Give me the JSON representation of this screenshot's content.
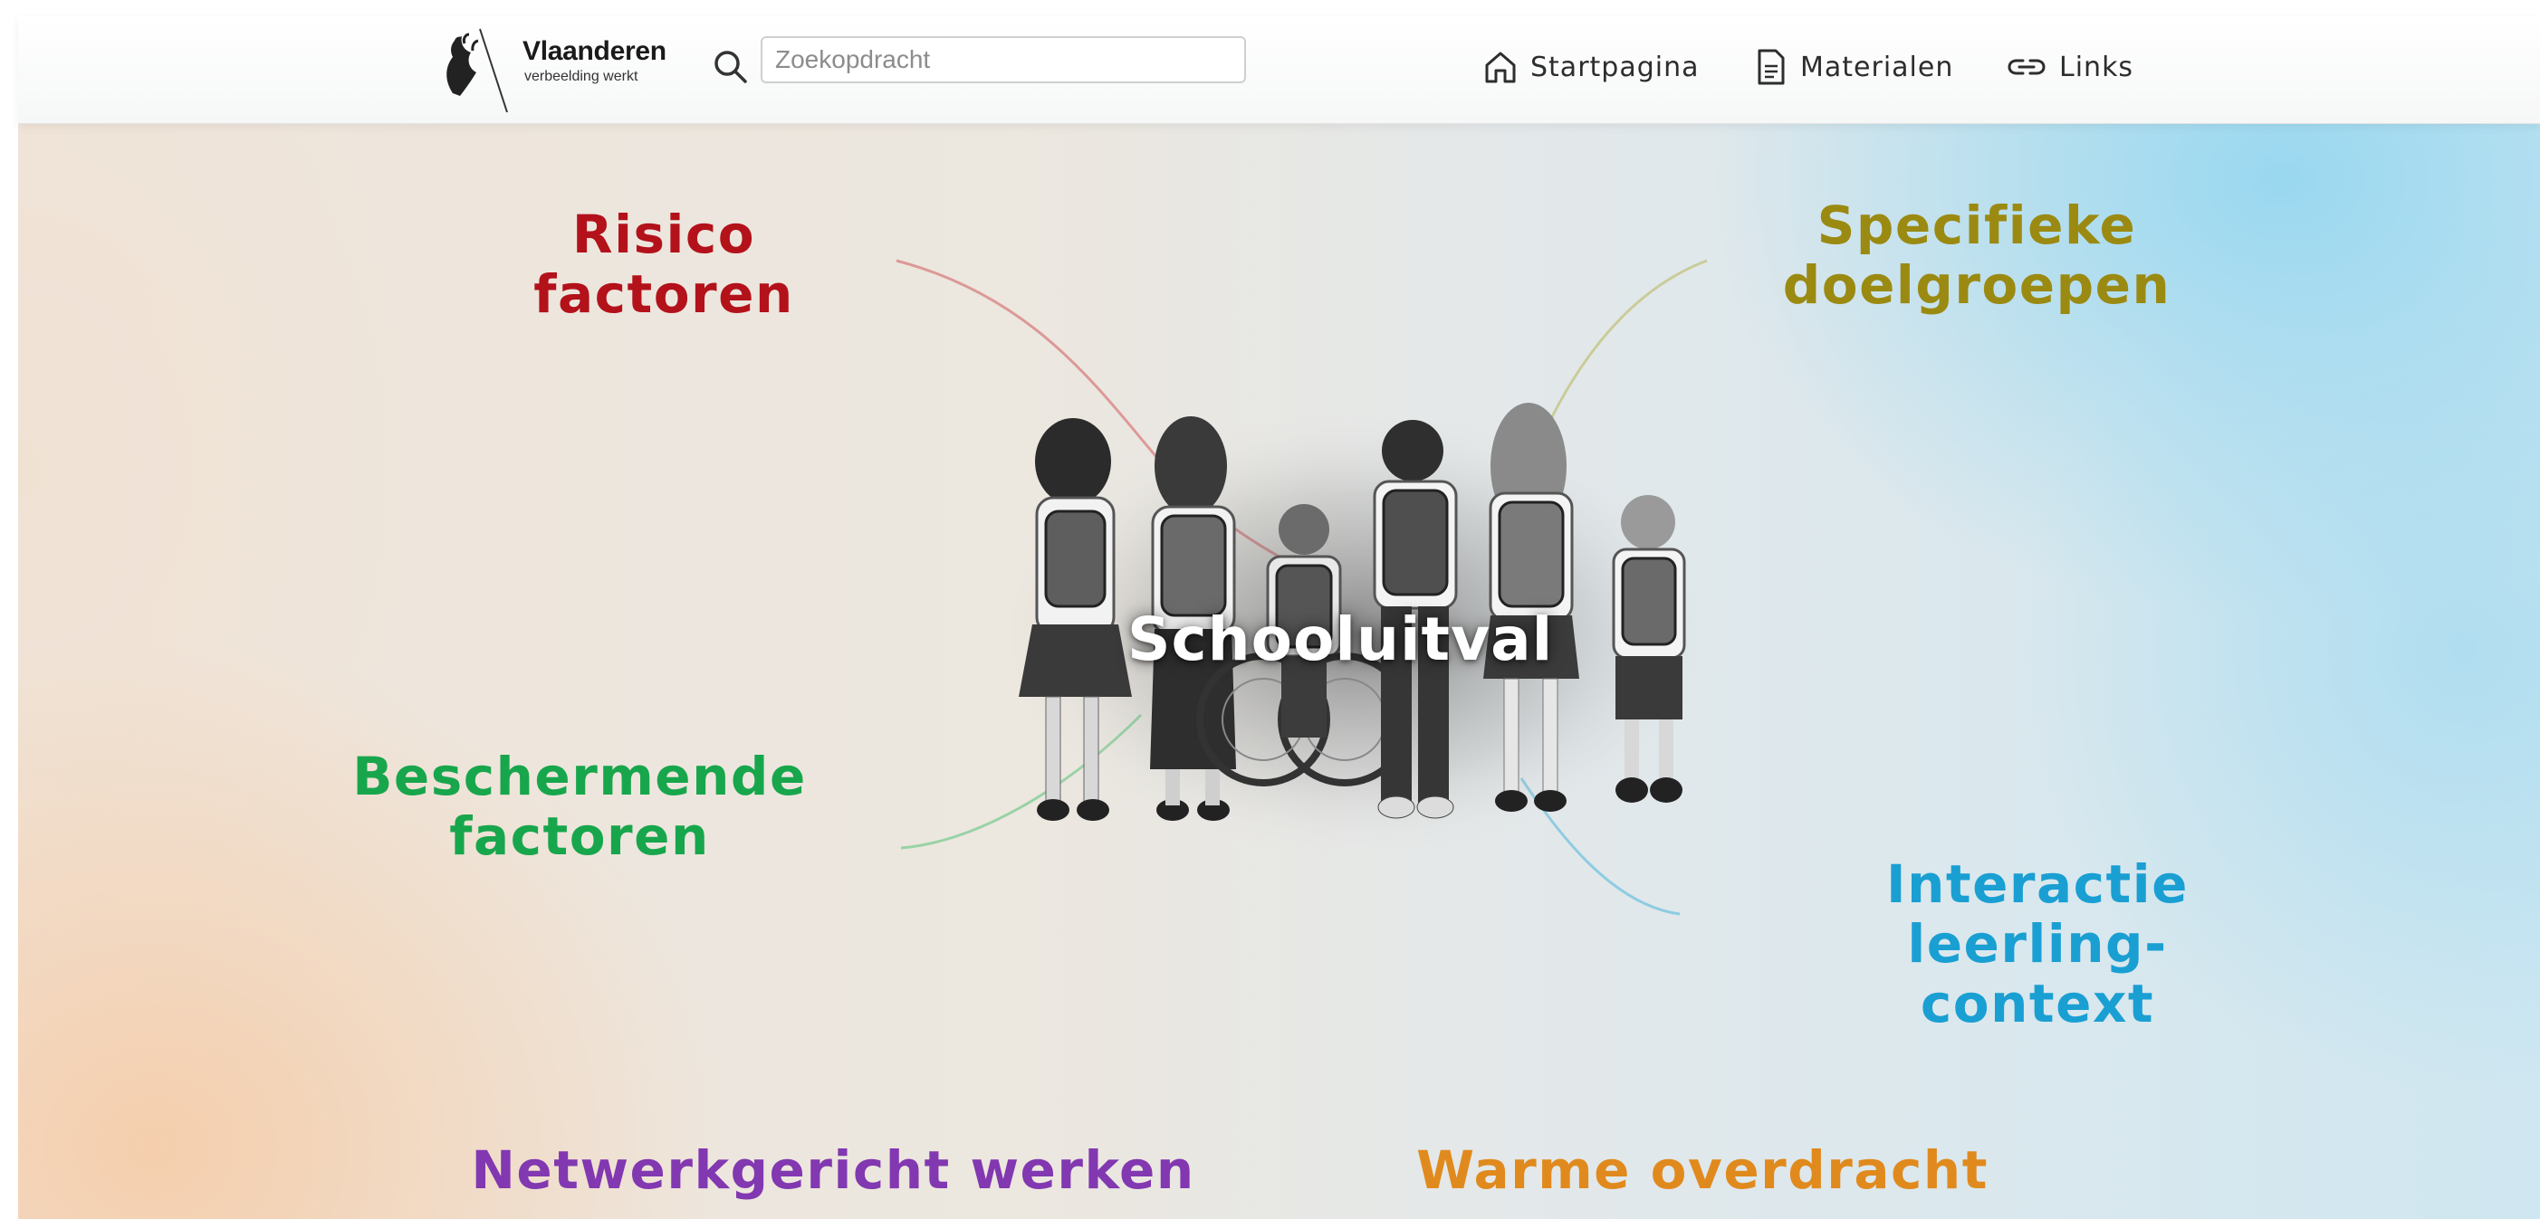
{
  "header": {
    "logo": {
      "title": "Vlaanderen",
      "subtitle": "verbeelding werkt"
    },
    "search": {
      "placeholder": "Zoekopdracht",
      "value": ""
    },
    "nav": [
      {
        "label": "Startpagina",
        "icon": "home-icon"
      },
      {
        "label": "Materialen",
        "icon": "document-icon"
      },
      {
        "label": "Links",
        "icon": "link-icon"
      }
    ]
  },
  "hero": {
    "title": "Schooluitval",
    "image": "children-walking-with-backpacks-illustration"
  },
  "topics": {
    "risico": {
      "lines": [
        "Risico",
        "factoren"
      ],
      "color": "#b3121b"
    },
    "specifieke": {
      "lines": [
        "Specifieke",
        "doelgroepen"
      ],
      "color": "#9b8a12"
    },
    "beschermende": {
      "lines": [
        "Beschermende",
        "factoren"
      ],
      "color": "#18a64c"
    },
    "interactie": {
      "lines": [
        "Interactie",
        "leerling-",
        "context"
      ],
      "color": "#1a9fd3"
    },
    "netwerk": {
      "lines": [
        "Netwerkgericht werken"
      ],
      "color": "#8238b0"
    },
    "warme": {
      "lines": [
        "Warme overdracht"
      ],
      "color": "#e08a1e"
    }
  },
  "colors": {
    "header_bg": "#ffffff",
    "text": "#2d2d2d"
  }
}
